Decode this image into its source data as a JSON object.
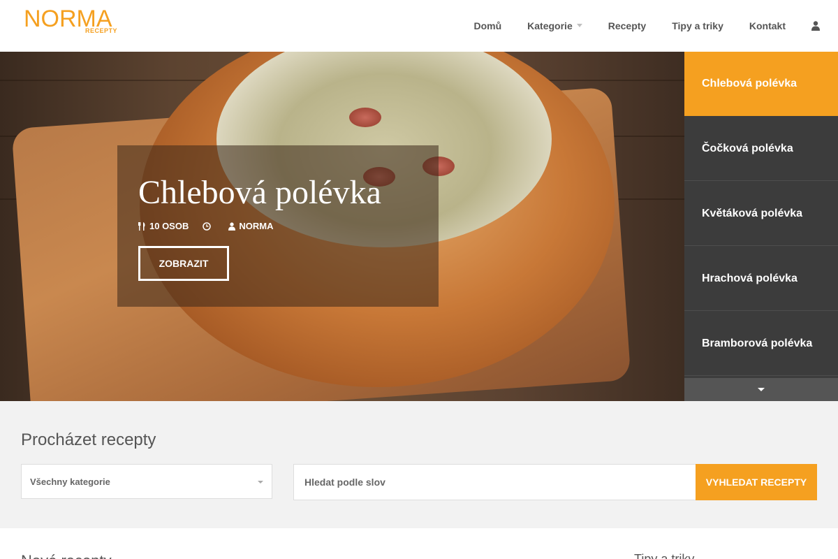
{
  "brand": {
    "logo_text": "NORMA",
    "logo_sub": "RECEPTY",
    "accent": "#f5a020"
  },
  "nav": {
    "items": [
      {
        "label": "Domů"
      },
      {
        "label": "Kategorie"
      },
      {
        "label": "Recepty"
      },
      {
        "label": "Tipy a triky"
      },
      {
        "label": "Kontakt"
      }
    ],
    "user_icon": "user-icon"
  },
  "hero": {
    "title": "Chlebová polévka",
    "meta": {
      "servings": "10 OSOB",
      "time": "",
      "author": "NORMA"
    },
    "button_label": "ZOBRAZIT"
  },
  "slider_list": {
    "items": [
      {
        "label": "Chlebová polévka",
        "active": true
      },
      {
        "label": "Čočková polévka"
      },
      {
        "label": "Květáková polévka"
      },
      {
        "label": "Hrachová polévka"
      },
      {
        "label": "Bramborová polévka"
      }
    ]
  },
  "browse": {
    "title": "Procházet recepty",
    "category_select": "Všechny kategorie",
    "search_placeholder": "Hledat podle slov",
    "search_button": "VYHLEDAT RECEPTY"
  },
  "bottom": {
    "left_title": "Nové recepty",
    "right_title": "Tipy a triky"
  }
}
